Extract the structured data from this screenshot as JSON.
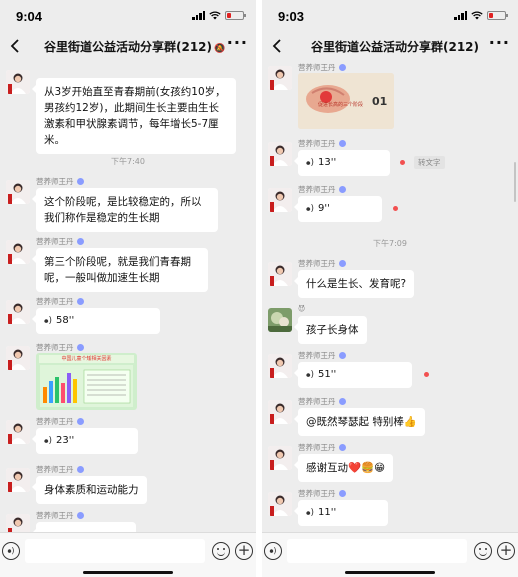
{
  "left": {
    "time": "9:04",
    "title": "谷里街道公益活动分享群(212)",
    "messages": {
      "m1": {
        "text": "从3岁开始直至青春期前(女孩约10岁，男孩约12岁)，此期间生长主要由生长激素和甲状腺素调节，每年增长5-7厘米。"
      },
      "ts1": "下午7:40",
      "m2": {
        "sender": "营养师王丹",
        "text": "这个阶段呢，是比较稳定的，所以我们称作是稳定的生长期"
      },
      "m3": {
        "sender": "营养师王丹",
        "text": "第三个阶段呢，就是我们青春期呢，一般叫做加速生长期"
      },
      "m4": {
        "sender": "营养师王丹",
        "voice": "58''"
      },
      "m5": {
        "sender": "营养师王丹",
        "card_title": "中国儿童个矮相关因素"
      },
      "m6": {
        "sender": "营养师王丹",
        "voice": "23''"
      },
      "m7": {
        "sender": "营养师王丹",
        "text": "身体素质和运动能力"
      },
      "m8": {
        "sender": "营养师王丹"
      }
    }
  },
  "right": {
    "time": "9:03",
    "title": "谷里街道公益活动分享群(212)",
    "messages": {
      "m0": {
        "sender": "营养师王丹",
        "card_title": "促进长高的三个阶段",
        "card_num": "01"
      },
      "m1": {
        "sender": "营养师王丹",
        "voice": "13''",
        "to_text": "转文字"
      },
      "m2": {
        "sender": "营养师王丹",
        "voice": "9''"
      },
      "ts1": "下午7:09",
      "m3": {
        "sender": "营养师王丹",
        "text": "什么是生长、发育呢?"
      },
      "m4": {
        "text": "孩子长身体"
      },
      "m5": {
        "sender": "营养师王丹",
        "voice": "51''"
      },
      "m6": {
        "sender": "营养师王丹",
        "text": "@既然琴瑟起 特别棒👍"
      },
      "m7": {
        "sender": "营养师王丹",
        "text": "感谢互动❤️🍔😁"
      },
      "m8": {
        "sender": "营养师王丹",
        "voice": "11''"
      }
    }
  },
  "colors": {
    "background": "#ededed",
    "bubble": "#ffffff",
    "unread": "#f25050",
    "accent": "#07c160"
  },
  "icons": [
    "back-icon",
    "mute-icon",
    "more-icon",
    "voice-input-icon",
    "emoji-icon",
    "plus-icon",
    "voice-wave-icon"
  ]
}
